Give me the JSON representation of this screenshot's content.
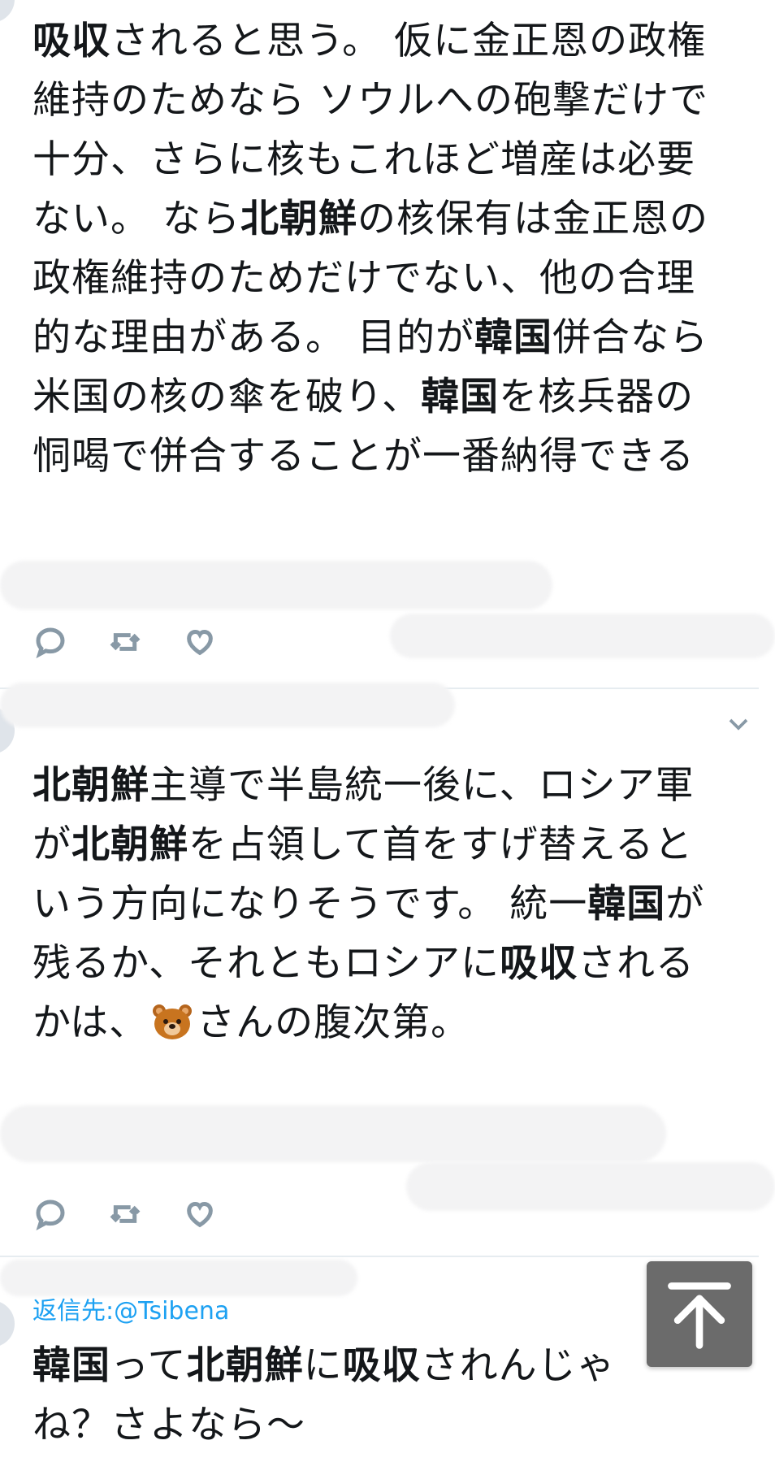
{
  "tweets": [
    {
      "segments": [
        {
          "t": "吸収",
          "b": true
        },
        {
          "t": "されると思う。 仮に金正恩の政権維持のためなら ソウルへの砲撃だけで十分、さらに核もこれほど増産は必要ない。 なら",
          "b": false
        },
        {
          "t": "北朝鮮",
          "b": true
        },
        {
          "t": "の核保有は金正恩の政権維持のためだけでない、他の合理的な理由がある。 目的が",
          "b": false
        },
        {
          "t": "韓国",
          "b": true
        },
        {
          "t": "併合なら 米国の核の傘を破り、",
          "b": false
        },
        {
          "t": "韓国",
          "b": true
        },
        {
          "t": "を核兵器の恫喝で併合することが一番納得できる",
          "b": false
        }
      ]
    },
    {
      "segments": [
        {
          "t": "北朝鮮",
          "b": true
        },
        {
          "t": "主導で半島統一後に、ロシア軍が",
          "b": false
        },
        {
          "t": "北朝鮮",
          "b": true
        },
        {
          "t": "を占領して首をすげ替えるという方向になりそうです。 統一",
          "b": false
        },
        {
          "t": "韓国",
          "b": true
        },
        {
          "t": "が残るか、それともロシアに",
          "b": false
        },
        {
          "t": "吸収",
          "b": true
        },
        {
          "t": "されるかは、",
          "b": false
        },
        {
          "t": "[bear]",
          "b": false
        },
        {
          "t": "さんの腹次第。",
          "b": false
        }
      ]
    },
    {
      "reply_to": "返信先:@Tsibena",
      "segments": [
        {
          "t": "韓国",
          "b": true
        },
        {
          "t": "って",
          "b": false
        },
        {
          "t": "北朝鮮",
          "b": true
        },
        {
          "t": "に",
          "b": false
        },
        {
          "t": "吸収",
          "b": true
        },
        {
          "t": "されんじゃね？さよなら〜",
          "b": false
        }
      ]
    }
  ],
  "icons": {
    "reply": "reply-icon",
    "retweet": "retweet-icon",
    "like": "heart-icon",
    "more": "chevron-down-icon",
    "scroll_top": "arrow-up-to-top-icon",
    "emoji": "bear-face-emoji"
  },
  "colors": {
    "text": "#14171a",
    "icon": "#8899a6",
    "link": "#1da1f2",
    "divider": "#e6ecf0",
    "scroll_button": "#6b6b6b"
  }
}
